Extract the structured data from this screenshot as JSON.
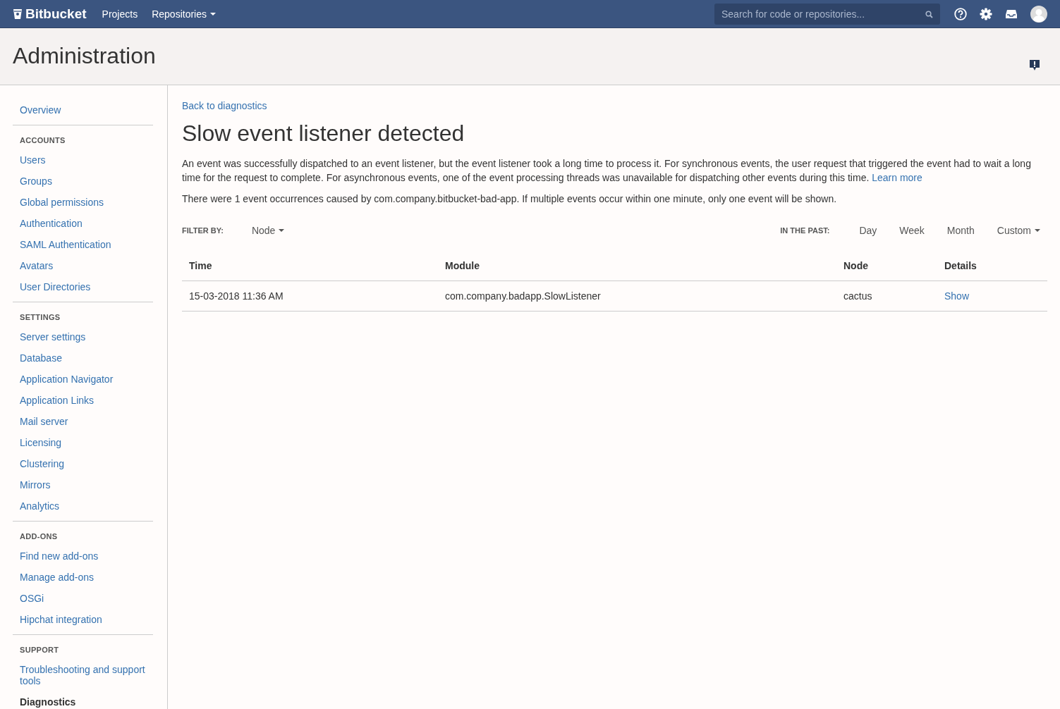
{
  "topbar": {
    "logo": "Bitbucket",
    "nav": [
      {
        "label": "Projects",
        "dropdown": false
      },
      {
        "label": "Repositories",
        "dropdown": true
      }
    ],
    "search": {
      "placeholder": "Search for code or repositories..."
    }
  },
  "header": {
    "title": "Administration"
  },
  "sidebar": {
    "sections": [
      {
        "items": [
          {
            "label": "Overview",
            "selected": false
          }
        ]
      },
      {
        "heading": "ACCOUNTS",
        "items": [
          {
            "label": "Users",
            "selected": false
          },
          {
            "label": "Groups",
            "selected": false
          },
          {
            "label": "Global permissions",
            "selected": false
          },
          {
            "label": "Authentication",
            "selected": false
          },
          {
            "label": "SAML Authentication",
            "selected": false
          },
          {
            "label": "Avatars",
            "selected": false
          },
          {
            "label": "User Directories",
            "selected": false
          }
        ]
      },
      {
        "heading": "SETTINGS",
        "items": [
          {
            "label": "Server settings",
            "selected": false
          },
          {
            "label": "Database",
            "selected": false
          },
          {
            "label": "Application Navigator",
            "selected": false
          },
          {
            "label": "Application Links",
            "selected": false
          },
          {
            "label": "Mail server",
            "selected": false
          },
          {
            "label": "Licensing",
            "selected": false
          },
          {
            "label": "Clustering",
            "selected": false
          },
          {
            "label": "Mirrors",
            "selected": false
          },
          {
            "label": "Analytics",
            "selected": false
          }
        ]
      },
      {
        "heading": "ADD-ONS",
        "items": [
          {
            "label": "Find new add-ons",
            "selected": false
          },
          {
            "label": "Manage add-ons",
            "selected": false
          },
          {
            "label": "OSGi",
            "selected": false
          },
          {
            "label": "Hipchat integration",
            "selected": false
          }
        ]
      },
      {
        "heading": "SUPPORT",
        "items": [
          {
            "label": "Troubleshooting and support tools",
            "selected": false
          },
          {
            "label": "Diagnostics",
            "selected": true
          }
        ]
      }
    ]
  },
  "content": {
    "back_link": "Back to diagnostics",
    "title": "Slow event listener detected",
    "description": "An event was successfully dispatched to an event listener, but the event listener took a long time to process it. For synchronous events, the user request that triggered the event had to wait a long time for the request to complete. For asynchronous events, one of the event processing threads was unavailable for dispatching other events during this time.",
    "learn_more": "Learn more",
    "occurrences": "There were 1 event occurrences caused by com.company.bitbucket-bad-app. If multiple events occur within one minute, only one event will be shown.",
    "filter": {
      "label": "FILTER BY:",
      "value": "Node"
    },
    "range": {
      "label": "IN THE PAST:",
      "options": [
        {
          "label": "Day",
          "dropdown": false
        },
        {
          "label": "Week",
          "dropdown": false
        },
        {
          "label": "Month",
          "dropdown": false
        },
        {
          "label": "Custom",
          "dropdown": true
        }
      ]
    },
    "table": {
      "columns": [
        "Time",
        "Module",
        "Node",
        "Details"
      ],
      "rows": [
        {
          "time": "15-03-2018 11:36 AM",
          "module": "com.company.badapp.SlowListener",
          "node": "cactus",
          "details": "Show"
        }
      ]
    }
  }
}
